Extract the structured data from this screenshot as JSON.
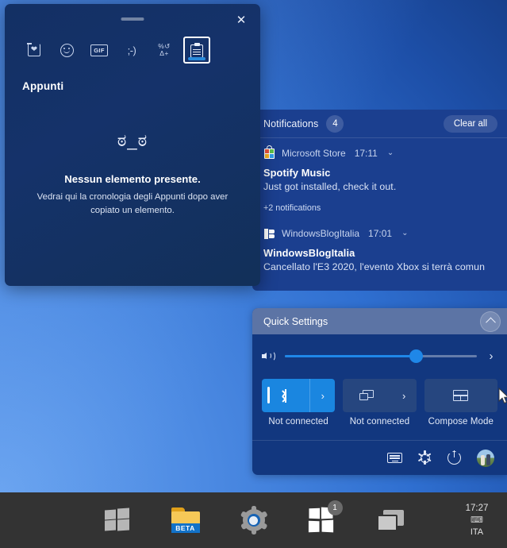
{
  "emoji_panel": {
    "title": "Appunti",
    "close_label": "✕",
    "tabs": [
      {
        "name": "recently-used",
        "glyph": "recent-heart-icon"
      },
      {
        "name": "emoji",
        "glyph": "smiley-icon"
      },
      {
        "name": "gif",
        "glyph": "gif-icon",
        "label": "GIF"
      },
      {
        "name": "kaomoji",
        "glyph": "kaomoji-icon",
        "label": ";-)"
      },
      {
        "name": "symbols",
        "glyph": "symbols-icon",
        "line1": "%↺",
        "line2": "Δ+"
      },
      {
        "name": "clipboard",
        "glyph": "clipboard-icon",
        "selected": true
      }
    ],
    "empty_state": {
      "kaomoji": "ಠ_ಠ",
      "title": "Nessun elemento presente.",
      "subtitle": "Vedrai qui la cronologia degli Appunti dopo aver copiato un elemento."
    }
  },
  "action_center": {
    "notifications": {
      "header_label": "Notifications",
      "count": "4",
      "clear_all_label": "Clear all",
      "items": [
        {
          "app": "Microsoft Store",
          "app_icon": "store-bag-icon",
          "time": "17:11",
          "chevron": "⌄",
          "title": "Spotify Music",
          "body": "Just got installed, check it out."
        },
        {
          "app": "WindowsBlogItalia",
          "app_icon": "windows-flag-icon",
          "time": "17:01",
          "chevron": "⌄",
          "title": "WindowsBlogItalia",
          "body": "Cancellato l'E3 2020, l'evento Xbox si terrà comun"
        }
      ],
      "more_label": "+2 notifications"
    },
    "quick_settings": {
      "header_label": "Quick Settings",
      "collapse_icon": "chevron-up-icon",
      "volume": {
        "icon": "speaker-icon",
        "value": 68,
        "expand_icon": "›"
      },
      "tiles": [
        {
          "name": "bluetooth",
          "icon": "bluetooth-icon",
          "label": "Not connected",
          "active": true,
          "expandable": true,
          "expand_icon": "›"
        },
        {
          "name": "project",
          "icon": "cast-icon",
          "label": "Not connected",
          "active": false,
          "expandable": true,
          "expand_icon": "›"
        },
        {
          "name": "compose-mode",
          "icon": "compose-mode-icon",
          "label": "Compose Mode",
          "active": false,
          "expandable": false
        }
      ],
      "footer_icons": [
        {
          "name": "keyboard-icon"
        },
        {
          "name": "gear-icon"
        },
        {
          "name": "power-icon"
        },
        {
          "name": "avatar"
        }
      ]
    }
  },
  "taskbar": {
    "items": [
      {
        "name": "start-button",
        "icon": "windows-logo-icon"
      },
      {
        "name": "file-explorer-button",
        "icon": "folder-beta-icon",
        "badge_text": "BETA"
      },
      {
        "name": "settings-button",
        "icon": "settings-gear-icon"
      },
      {
        "name": "windows-insider-button",
        "icon": "windows-insider-icon",
        "badge": "1"
      },
      {
        "name": "task-view-button",
        "icon": "task-view-icon"
      }
    ],
    "tray": {
      "time": "17:27",
      "ime_icon": "ime-icon",
      "language": "ITA"
    }
  }
}
